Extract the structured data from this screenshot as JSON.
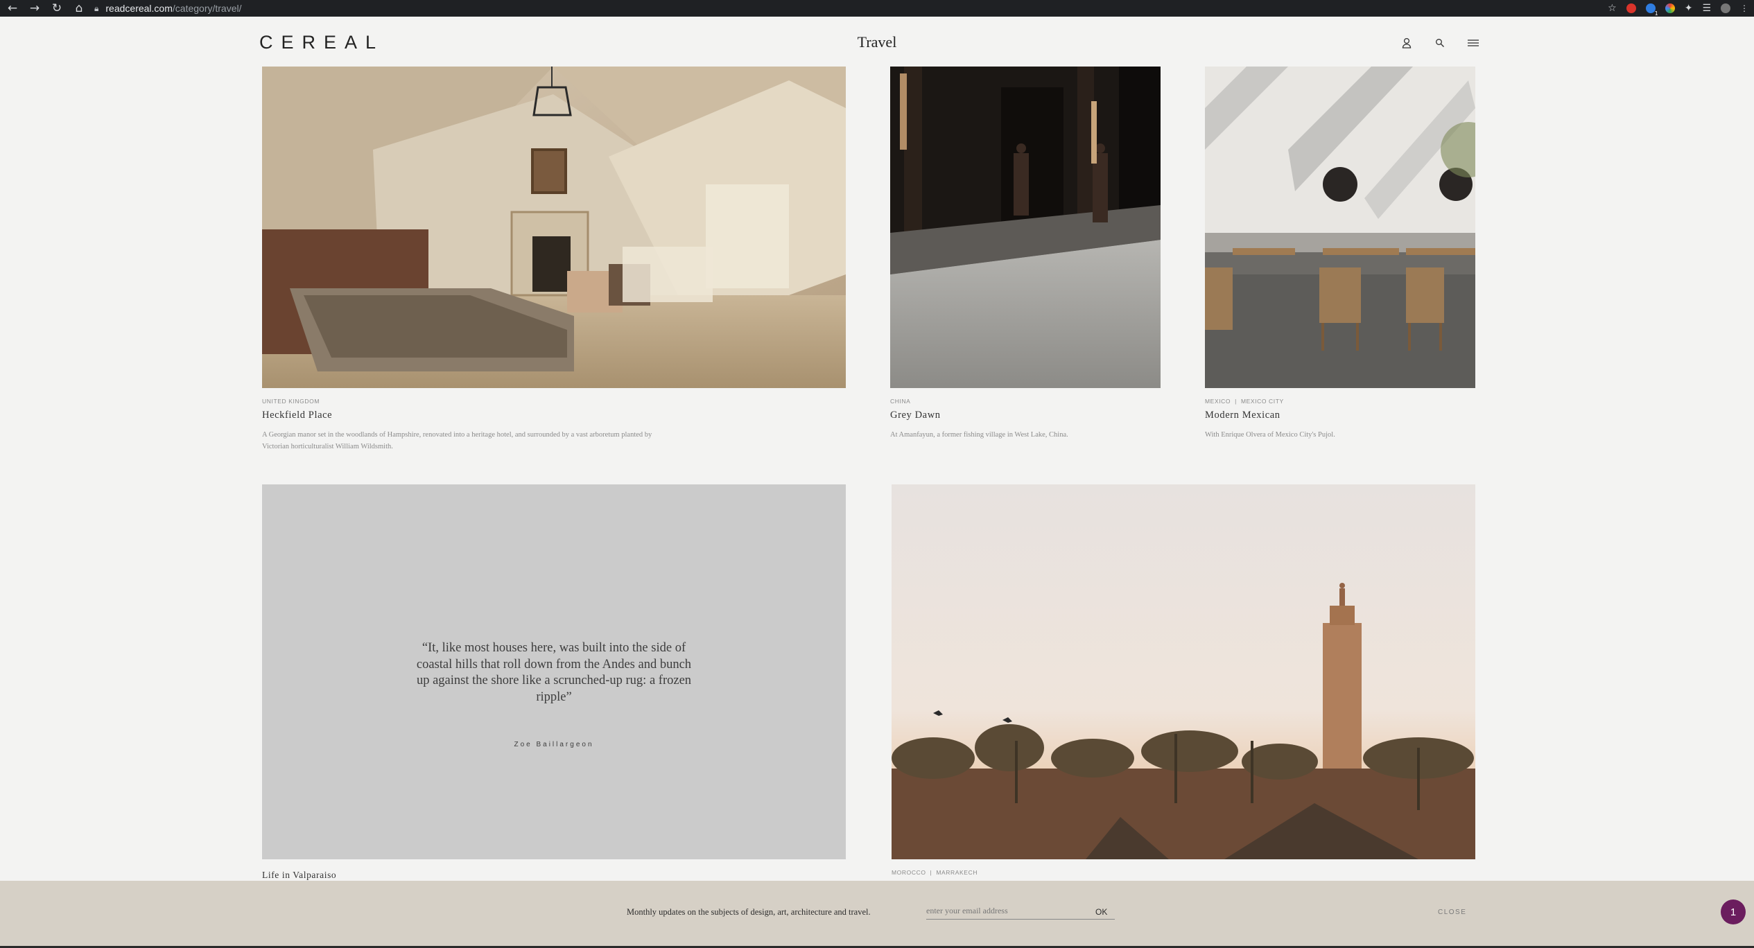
{
  "browser": {
    "url_host": "readcereal.com",
    "url_path": "/category/travel/",
    "nav_icons": [
      "back-arrow-icon",
      "forward-arrow-icon",
      "reload-icon",
      "home-icon"
    ],
    "extension_badge": "1"
  },
  "header": {
    "logo": "CEREAL",
    "section_title": "Travel"
  },
  "articles": [
    {
      "location": [
        "UNITED KINGDOM"
      ],
      "title": "Heckfield Place",
      "description": "A Georgian manor set in the woodlands of Hampshire, renovated into a heritage hotel, and surrounded by a vast arboretum planted by Victorian horticulturalist William Wildsmith."
    },
    {
      "location": [
        "CHINA"
      ],
      "title": "Grey Dawn",
      "description": "At Amanfayun, a former fishing village in West Lake, China."
    },
    {
      "location": [
        "MEXICO",
        "MEXICO CITY"
      ],
      "title": "Modern Mexican",
      "description": "With Enrique Olvera of Mexico City's Pujol."
    },
    {
      "quote": "“It, like most houses here, was built into the side of coastal hills that roll down from the Andes and bunch up against the shore like a scrunched-up rug: a frozen ripple”",
      "author": "Zoe Baillargeon",
      "title": "Life in Valparaiso"
    },
    {
      "location": [
        "MOROCCO",
        "MARRAKECH"
      ]
    }
  ],
  "separator": "|",
  "newsletter": {
    "text": "Monthly updates on the subjects of design, art, architecture and travel.",
    "placeholder": "enter your email address",
    "ok_label": "OK",
    "close_label": "CLOSE"
  },
  "chat_badge": "1"
}
